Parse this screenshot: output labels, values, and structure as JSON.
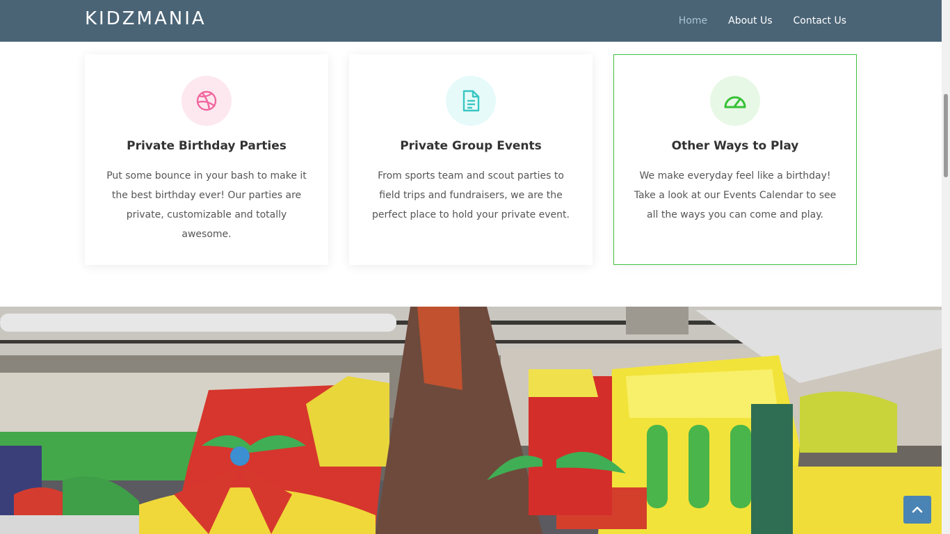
{
  "header": {
    "brand": "KIDZMANIA",
    "nav": [
      {
        "label": "Home",
        "active": true
      },
      {
        "label": "About Us",
        "active": false
      },
      {
        "label": "Contact Us",
        "active": false
      }
    ]
  },
  "services": [
    {
      "icon": "dribbble-icon",
      "icon_color": "#f0679e",
      "icon_bg": "#fde8ef",
      "title": "Private Birthday Parties",
      "text": "Put some bounce in your bash to make it the best birthday ever! Our parties are private, customizable and totally awesome."
    },
    {
      "icon": "document-icon",
      "icon_color": "#39c6c2",
      "icon_bg": "#e6fafa",
      "title": "Private Group Events",
      "text": "From sports team and scout parties to field trips and fundraisers, we are the perfect place to hold your private event."
    },
    {
      "icon": "speedometer-icon",
      "icon_color": "#36c136",
      "icon_bg": "#e8f8e6",
      "title": "Other Ways to Play",
      "text": "We make everyday feel like a birthday! Take a look at our Events Calendar to see all the ways you can come and play.",
      "highlighted": true
    }
  ],
  "photo": {
    "subject": "indoor-inflatable-play-area"
  },
  "back_to_top": {
    "icon": "chevron-up-icon"
  },
  "colors": {
    "nav_bg": "#4a6476",
    "accent_green": "#3dc23d",
    "back_to_top_bg": "#4a84b4"
  }
}
